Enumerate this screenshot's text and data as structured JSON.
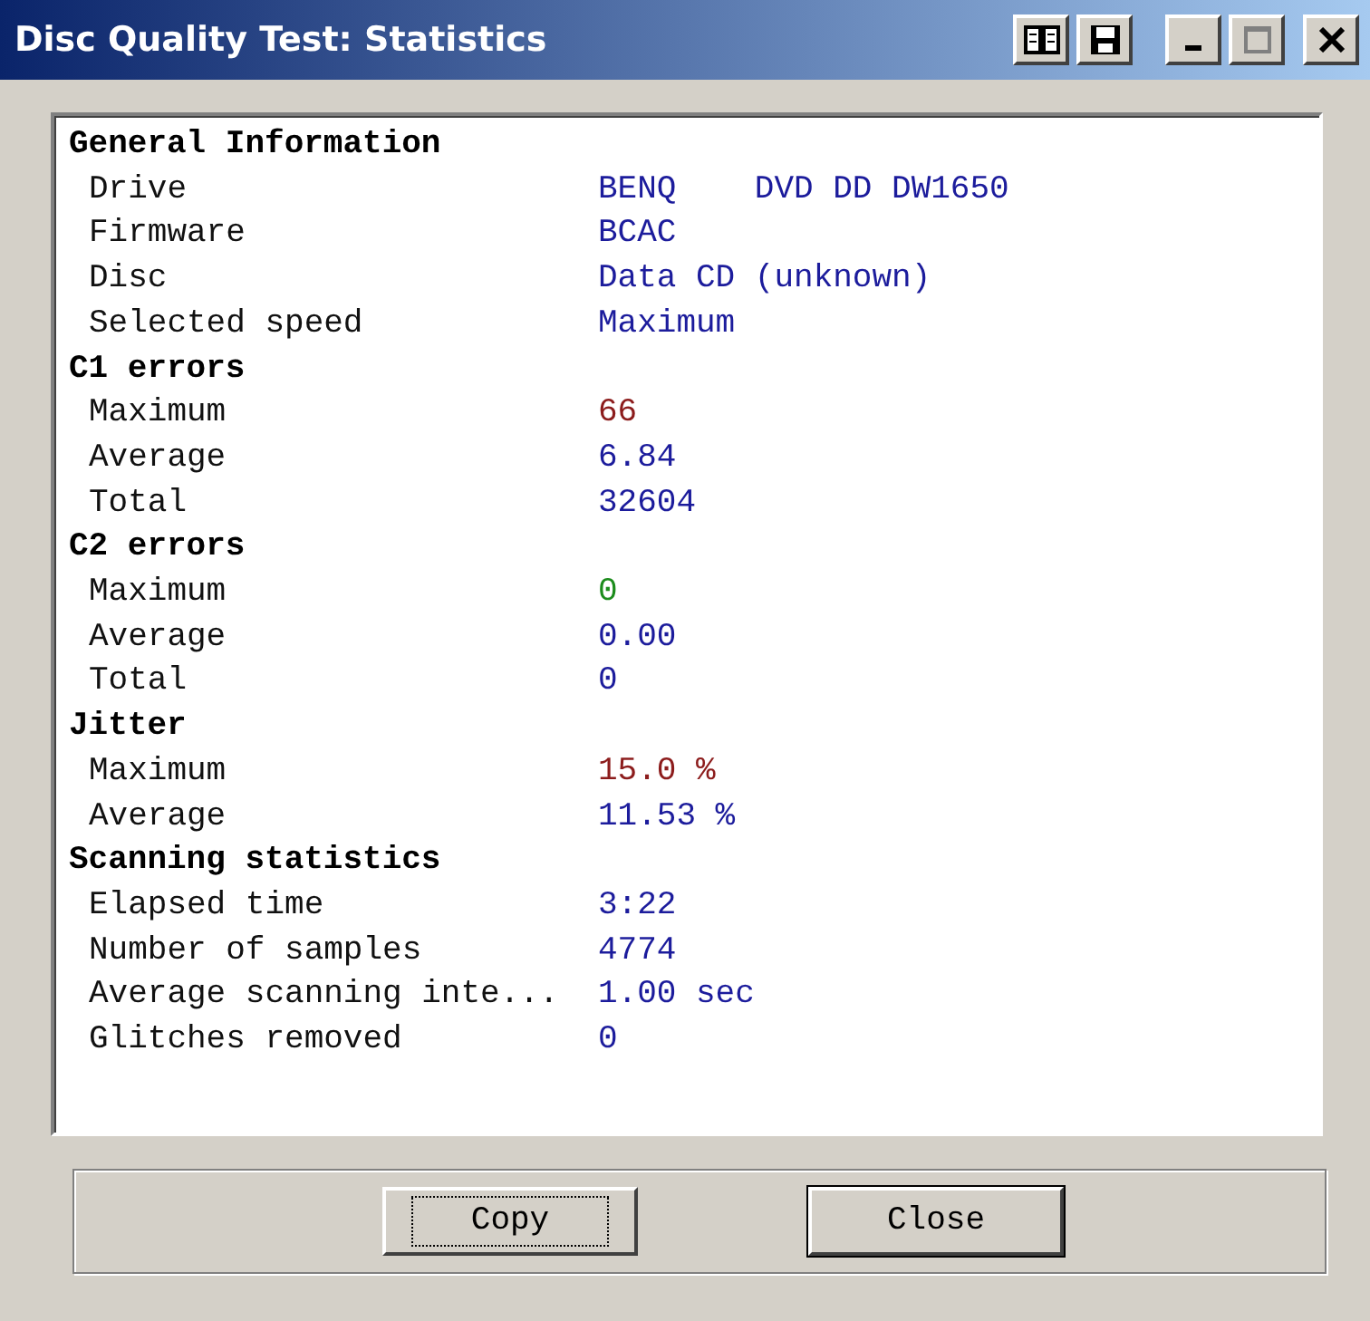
{
  "window": {
    "title": "Disc Quality Test: Statistics"
  },
  "sections": [
    {
      "heading": "General Information",
      "rows": [
        {
          "label": "Drive",
          "value": "BENQ    DVD DD DW1650",
          "color": "#1c1c9c"
        },
        {
          "label": "Firmware",
          "value": "BCAC",
          "color": "#1c1c9c"
        },
        {
          "label": "Disc",
          "value": "Data CD (unknown)",
          "color": "#1c1c9c"
        },
        {
          "label": "Selected speed",
          "value": "Maximum",
          "color": "#1c1c9c"
        }
      ]
    },
    {
      "heading": "C1 errors",
      "rows": [
        {
          "label": "Maximum",
          "value": "66",
          "color": "#8c1c1c"
        },
        {
          "label": "Average",
          "value": "6.84",
          "color": "#1c1c9c"
        },
        {
          "label": "Total",
          "value": "32604",
          "color": "#1c1c9c"
        }
      ]
    },
    {
      "heading": "C2 errors",
      "rows": [
        {
          "label": "Maximum",
          "value": "0",
          "color": "#1c8c1c"
        },
        {
          "label": "Average",
          "value": "0.00",
          "color": "#1c1c9c"
        },
        {
          "label": "Total",
          "value": "0",
          "color": "#1c1c9c"
        }
      ]
    },
    {
      "heading": "Jitter",
      "rows": [
        {
          "label": "Maximum",
          "value": "15.0 %",
          "color": "#8c1c1c"
        },
        {
          "label": "Average",
          "value": "11.53 %",
          "color": "#1c1c9c"
        }
      ]
    },
    {
      "heading": "Scanning statistics",
      "rows": [
        {
          "label": "Elapsed time",
          "value": "3:22",
          "color": "#1c1c9c"
        },
        {
          "label": "Number of samples",
          "value": "4774",
          "color": "#1c1c9c"
        },
        {
          "label": "Average scanning inte...",
          "value": "1.00 sec",
          "color": "#1c1c9c"
        },
        {
          "label": "Glitches removed",
          "value": "0",
          "color": "#1c1c9c"
        }
      ]
    }
  ],
  "buttons": [
    {
      "label": "Copy",
      "focused": true,
      "default": false
    },
    {
      "label": "Close",
      "focused": false,
      "default": true
    }
  ]
}
